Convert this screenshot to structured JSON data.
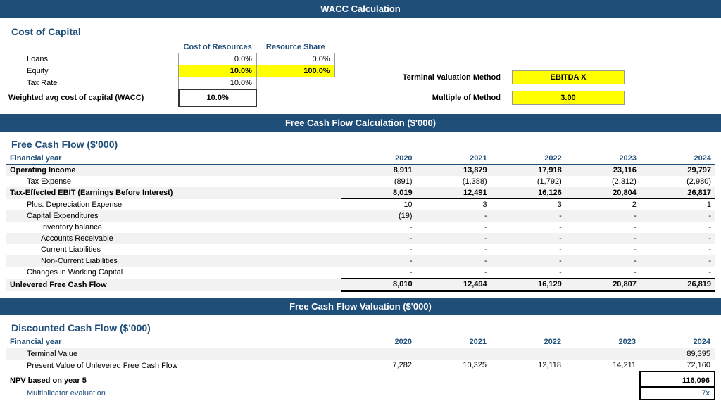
{
  "title": "WACC Calculation",
  "sections": {
    "cost_of_capital": {
      "title": "Cost of Capital",
      "header1": "Cost of Resources",
      "header2": "Resource Share",
      "rows": [
        {
          "label": "Loans",
          "cost": "0.0%",
          "share": "0.0%"
        },
        {
          "label": "Equity",
          "cost": "10.0%",
          "share": "100.0%"
        },
        {
          "label": "Tax Rate",
          "cost": "10.0%",
          "share": ""
        },
        {
          "label": "Weighted avg cost of capital (WACC)",
          "cost": "10.0%",
          "share": ""
        }
      ],
      "terminal": {
        "method_label": "Terminal Valuation Method",
        "method_value": "EBITDA X",
        "multiple_label": "Multiple of Method",
        "multiple_value": "3.00"
      }
    },
    "fcf_section_header": "Free Cash Flow Calculation ($'000)",
    "fcf": {
      "title": "Free Cash Flow ($'000)",
      "col_label": "Financial year",
      "years": [
        "2020",
        "2021",
        "2022",
        "2023",
        "2024"
      ],
      "rows": [
        {
          "label": "Operating Income",
          "type": "bold",
          "values": [
            "8,911",
            "13,879",
            "17,918",
            "23,116",
            "29,797"
          ]
        },
        {
          "label": "Tax Expense",
          "type": "indent1",
          "values": [
            "(891)",
            "(1,388)",
            "(1,792)",
            "(2,312)",
            "(2,980)"
          ]
        },
        {
          "label": "Tax-Effected EBIT (Earnings Before Interest)",
          "type": "bold underline",
          "values": [
            "8,019",
            "12,491",
            "16,126",
            "20,804",
            "26,817"
          ]
        },
        {
          "label": "Plus: Depreciation Expense",
          "type": "indent1",
          "values": [
            "10",
            "3",
            "3",
            "2",
            "1"
          ]
        },
        {
          "label": "Capital Expenditures",
          "type": "indent1",
          "values": [
            "(19)",
            "-",
            "-",
            "-",
            "-"
          ]
        },
        {
          "label": "Inventory balance",
          "type": "indent2",
          "values": [
            "-",
            "-",
            "-",
            "-",
            "-"
          ]
        },
        {
          "label": "Accounts Receivable",
          "type": "indent2",
          "values": [
            "-",
            "-",
            "-",
            "-",
            "-"
          ]
        },
        {
          "label": "Current Liabilities",
          "type": "indent2",
          "values": [
            "-",
            "-",
            "-",
            "-",
            "-"
          ]
        },
        {
          "label": "Non-Current Liabilities",
          "type": "indent2",
          "values": [
            "-",
            "-",
            "-",
            "-",
            "-"
          ]
        },
        {
          "label": "Changes in Working Capital",
          "type": "indent1 underline",
          "values": [
            "-",
            "-",
            "-",
            "-",
            "-"
          ]
        },
        {
          "label": "Unlevered Free Cash Flow",
          "type": "bold double-underline",
          "values": [
            "8,010",
            "12,494",
            "16,129",
            "20,807",
            "26,819"
          ]
        }
      ]
    },
    "valuation_header": "Free Cash Flow Valuation ($'000)",
    "dcf": {
      "title": "Discounted Cash Flow ($'000)",
      "col_label": "Financial year",
      "years": [
        "2020",
        "2021",
        "2022",
        "2023",
        "2024"
      ],
      "rows": [
        {
          "label": "Terminal Value",
          "type": "normal",
          "values": [
            "",
            "",
            "",
            "",
            "89,395"
          ]
        },
        {
          "label": "Present Value of Unlevered Free Cash Flow",
          "type": "normal underline",
          "values": [
            "7,282",
            "10,325",
            "12,118",
            "14,211",
            "72,160"
          ]
        }
      ],
      "npv": {
        "label": "NPV based on year 5",
        "value": "116,096"
      },
      "multiplicator": {
        "label": "Multiplicator evaluation",
        "value": "7x"
      }
    }
  },
  "colors": {
    "header_bg": "#1f4e79",
    "yellow": "#ffff00",
    "gray": "#d9d9d9",
    "light_gray": "#f2f2f2",
    "blue_text": "#1f4e79"
  }
}
